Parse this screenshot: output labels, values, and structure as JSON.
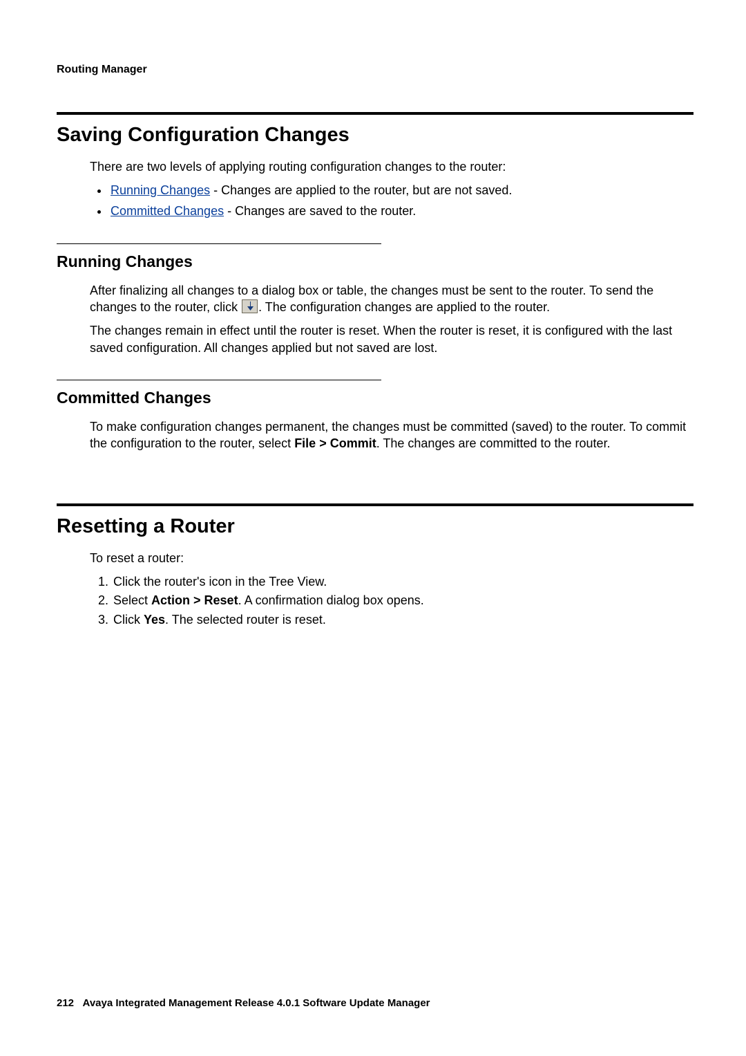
{
  "header": {
    "title": "Routing Manager"
  },
  "section_saving": {
    "heading": "Saving Configuration Changes",
    "intro": "There are two levels of applying routing configuration changes to the router:",
    "bullets": [
      {
        "link": "Running Changes",
        "rest": " - Changes are applied to the router, but are not saved."
      },
      {
        "link": "Committed Changes",
        "rest": " - Changes are saved to the router."
      }
    ]
  },
  "sub_running": {
    "heading": "Running Changes",
    "p1a": "After finalizing all changes to a dialog box or table, the changes must be sent to the router. To send the changes to the router, click ",
    "p1b": ". The configuration changes are applied to the router.",
    "p2": "The changes remain in effect until the router is reset. When the router is reset, it is configured with the last saved configuration. All changes applied but not saved are lost."
  },
  "sub_committed": {
    "heading": "Committed Changes",
    "p1a": "To make configuration changes permanent, the changes must be committed (saved) to the router. To commit the configuration to the router, select ",
    "bold": "File > Commit",
    "p1b": ". The changes are committed to the router."
  },
  "section_reset": {
    "heading": "Resetting a Router",
    "intro": "To reset a router:",
    "steps": {
      "s1": "Click the router's icon in the Tree View.",
      "s2a": "Select ",
      "s2bold": "Action > Reset",
      "s2b": ". A confirmation dialog box opens.",
      "s3a": "Click ",
      "s3bold": "Yes",
      "s3b": ". The selected router is reset."
    }
  },
  "footer": {
    "page": "212",
    "title": "Avaya Integrated Management Release 4.0.1 Software Update Manager"
  }
}
